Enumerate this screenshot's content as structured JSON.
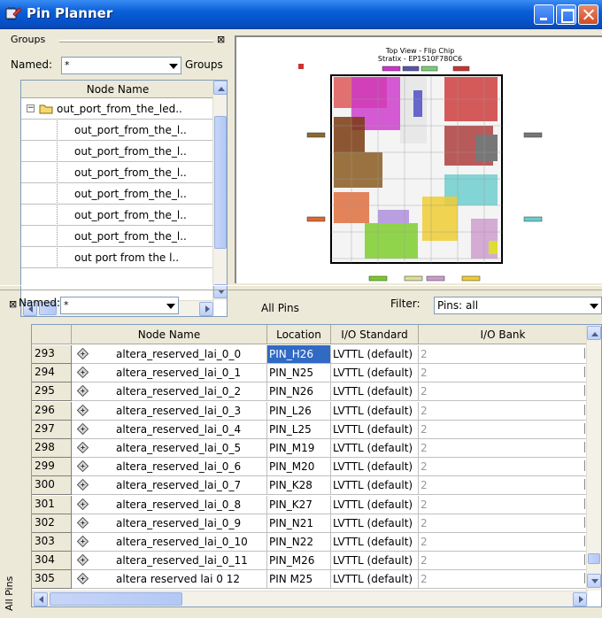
{
  "window": {
    "title": "Pin Planner"
  },
  "groups": {
    "title": "Groups",
    "named_label": "Named:",
    "named_value": "*",
    "groups_button": "Groups",
    "column_header": "Node Name",
    "items": [
      {
        "label": "out_port_from_the_led..",
        "is_parent": true
      },
      {
        "label": "out_port_from_the_l.."
      },
      {
        "label": "out_port_from_the_l.."
      },
      {
        "label": "out_port_from_the_l.."
      },
      {
        "label": "out_port_from_the_l.."
      },
      {
        "label": "out_port_from_the_l.."
      },
      {
        "label": "out_port_from_the_l.."
      },
      {
        "label": "out port from the l.."
      }
    ]
  },
  "chip_view": {
    "title": "Top View - Flip Chip",
    "subtitle": "Stratix - EP1S10F780C6"
  },
  "all_pins": {
    "title": "All Pins",
    "named_label": "Named:",
    "named_value": "*",
    "filter_label": "Filter:",
    "filter_value": "Pins: all",
    "side_label": "All Pins",
    "columns": [
      "Node Name",
      "Location",
      "I/O Standard",
      "I/O Bank"
    ],
    "rows": [
      {
        "num": "293",
        "node": "altera_reserved_lai_0_0",
        "location": "PIN_H26",
        "io": "LVTTL (default)",
        "bank": "2",
        "selected": true
      },
      {
        "num": "294",
        "node": "altera_reserved_lai_0_1",
        "location": "PIN_N25",
        "io": "LVTTL (default)",
        "bank": "2"
      },
      {
        "num": "295",
        "node": "altera_reserved_lai_0_2",
        "location": "PIN_N26",
        "io": "LVTTL (default)",
        "bank": "2"
      },
      {
        "num": "296",
        "node": "altera_reserved_lai_0_3",
        "location": "PIN_L26",
        "io": "LVTTL (default)",
        "bank": "2"
      },
      {
        "num": "297",
        "node": "altera_reserved_lai_0_4",
        "location": "PIN_L25",
        "io": "LVTTL (default)",
        "bank": "2"
      },
      {
        "num": "298",
        "node": "altera_reserved_lai_0_5",
        "location": "PIN_M19",
        "io": "LVTTL (default)",
        "bank": "2"
      },
      {
        "num": "299",
        "node": "altera_reserved_lai_0_6",
        "location": "PIN_M20",
        "io": "LVTTL (default)",
        "bank": "2"
      },
      {
        "num": "300",
        "node": "altera_reserved_lai_0_7",
        "location": "PIN_K28",
        "io": "LVTTL (default)",
        "bank": "2"
      },
      {
        "num": "301",
        "node": "altera_reserved_lai_0_8",
        "location": "PIN_K27",
        "io": "LVTTL (default)",
        "bank": "2"
      },
      {
        "num": "302",
        "node": "altera_reserved_lai_0_9",
        "location": "PIN_N21",
        "io": "LVTTL (default)",
        "bank": "2"
      },
      {
        "num": "303",
        "node": "altera_reserved_lai_0_10",
        "location": "PIN_N22",
        "io": "LVTTL (default)",
        "bank": "2"
      },
      {
        "num": "304",
        "node": "altera_reserved_lai_0_11",
        "location": "PIN_M26",
        "io": "LVTTL (default)",
        "bank": "2"
      },
      {
        "num": "305",
        "node": "altera reserved lai 0 12",
        "location": "PIN M25",
        "io": "LVTTL (default)",
        "bank": "2"
      }
    ]
  }
}
